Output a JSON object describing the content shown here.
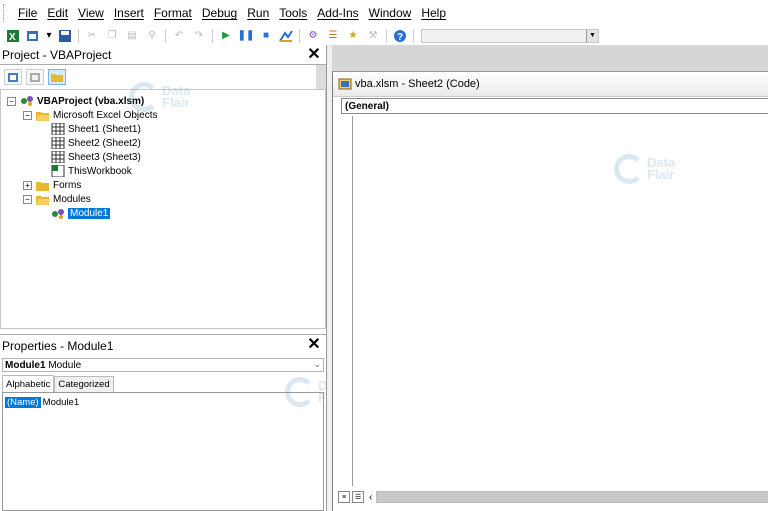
{
  "menubar": {
    "items": [
      "File",
      "Edit",
      "View",
      "Insert",
      "Format",
      "Debug",
      "Run",
      "Tools",
      "Add-Ins",
      "Window",
      "Help"
    ]
  },
  "project_panel": {
    "title": "Project - VBAProject",
    "close_label": "✕",
    "tree": {
      "root": "VBAProject (vba.xlsm)",
      "excel_objects": "Microsoft Excel Objects",
      "sheet1": "Sheet1 (Sheet1)",
      "sheet2": "Sheet2 (Sheet2)",
      "sheet3": "Sheet3 (Sheet3)",
      "workbook": "ThisWorkbook",
      "forms": "Forms",
      "modules": "Modules",
      "module1": "Module1"
    }
  },
  "properties_panel": {
    "title": "Properties - Module1",
    "close_label": "✕",
    "object_name": "Module1",
    "object_type": "Module",
    "tabs": [
      "Alphabetic",
      "Categorized"
    ],
    "row_name": "(Name)",
    "row_value": "Module1"
  },
  "code_window": {
    "title": "vba.xlsm - Sheet2 (Code)",
    "object_combo": "(General)"
  },
  "watermark": {
    "line1": "Data",
    "line2": "Flair"
  },
  "colors": {
    "selection": "#0078d7",
    "mdi_background": "#ababab"
  }
}
